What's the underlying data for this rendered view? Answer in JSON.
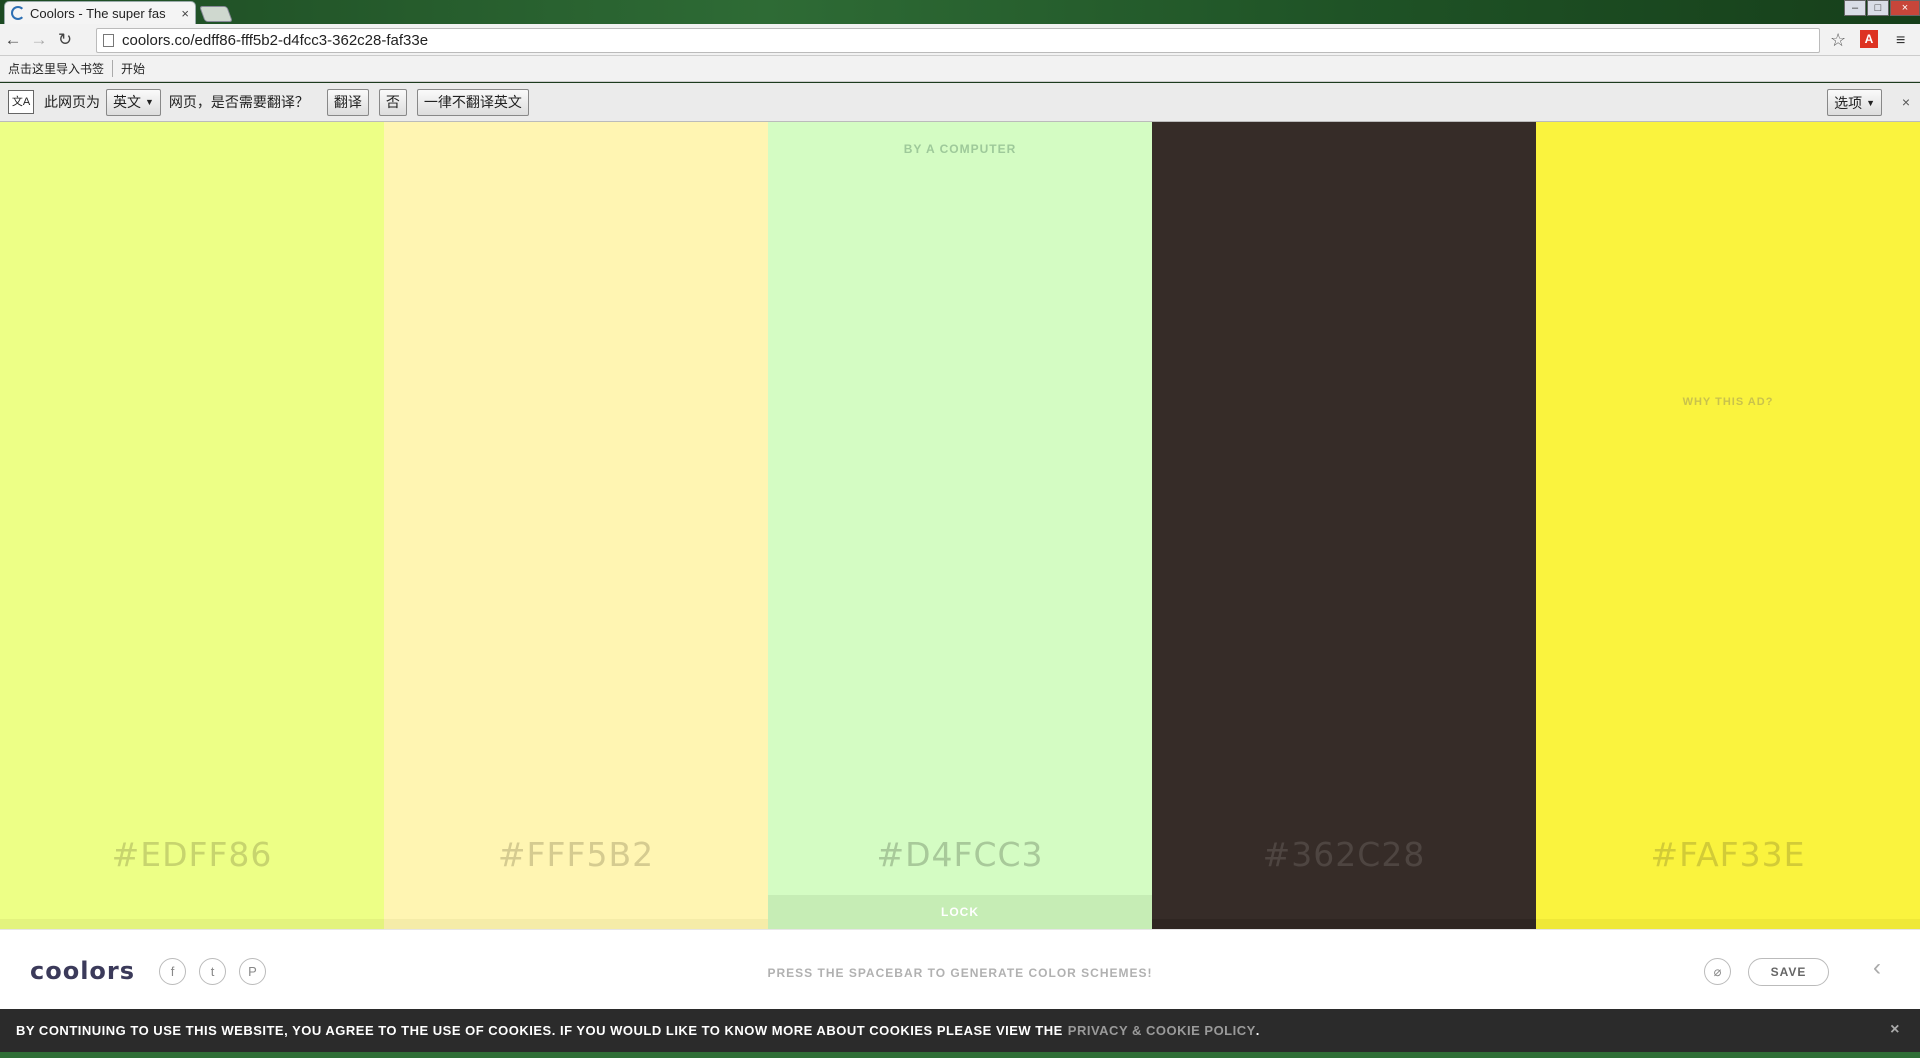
{
  "browser": {
    "tab_title": "Coolors - The super fas",
    "tab_close": "×",
    "url": "coolors.co/edff86-fff5b2-d4fcc3-362c28-faf33e",
    "back": "←",
    "forward": "→",
    "reload": "↻",
    "star": "☆",
    "ext_label": "A",
    "menu": "≡",
    "window_controls": {
      "minimize": "–",
      "maximize": "□",
      "close": "×"
    }
  },
  "bookmarks": {
    "import": "点击这里导入书签",
    "start": "开始"
  },
  "translate_bar": {
    "icon_text": "文A",
    "prefix": "此网页为",
    "language": "英文",
    "question": "网页，是否需要翻译？",
    "translate": "翻译",
    "no": "否",
    "never": "一律不翻译英文",
    "options": "选项",
    "close": "×"
  },
  "palette": {
    "colors": [
      {
        "hex": "#EDFF86",
        "bg": "#edff86",
        "text_color": "#c7d46e",
        "strip": "#e3f37e"
      },
      {
        "hex": "#FFF5B2",
        "bg": "#fff5b2",
        "text_color": "#d5cb90",
        "strip": "#f5eca8"
      },
      {
        "hex": "#D4FCC3",
        "bg": "#d4fcc3",
        "text_color": "#a8c99a",
        "strip": "#c6edb5"
      },
      {
        "hex": "#362C28",
        "bg": "#362c28",
        "text_color": "#4e4541",
        "strip": "#2f2622"
      },
      {
        "hex": "#FAF33E",
        "bg": "#faf33e",
        "text_color": "#d2cb37",
        "strip": "#efe838"
      }
    ],
    "lock_label": "LOCK",
    "ad_label": "BY A COMPUTER",
    "why_ad": "WHY THIS AD?"
  },
  "footer": {
    "logo": "coolors",
    "social": [
      {
        "name": "facebook",
        "glyph": "f"
      },
      {
        "name": "twitter",
        "glyph": "t"
      },
      {
        "name": "pinterest",
        "glyph": "P"
      }
    ],
    "hint": "PRESS THE SPACEBAR TO GENERATE COLOR SCHEMES!",
    "adjust_glyph": "⌀",
    "save": "SAVE",
    "chevron": "‹"
  },
  "cookie": {
    "text": "BY CONTINUING TO USE THIS WEBSITE, YOU AGREE TO THE USE OF COOKIES. IF YOU WOULD LIKE TO KNOW MORE ABOUT COOKIES PLEASE VIEW THE",
    "link": "PRIVACY & COOKIE POLICY",
    "suffix": ".",
    "close": "×"
  }
}
